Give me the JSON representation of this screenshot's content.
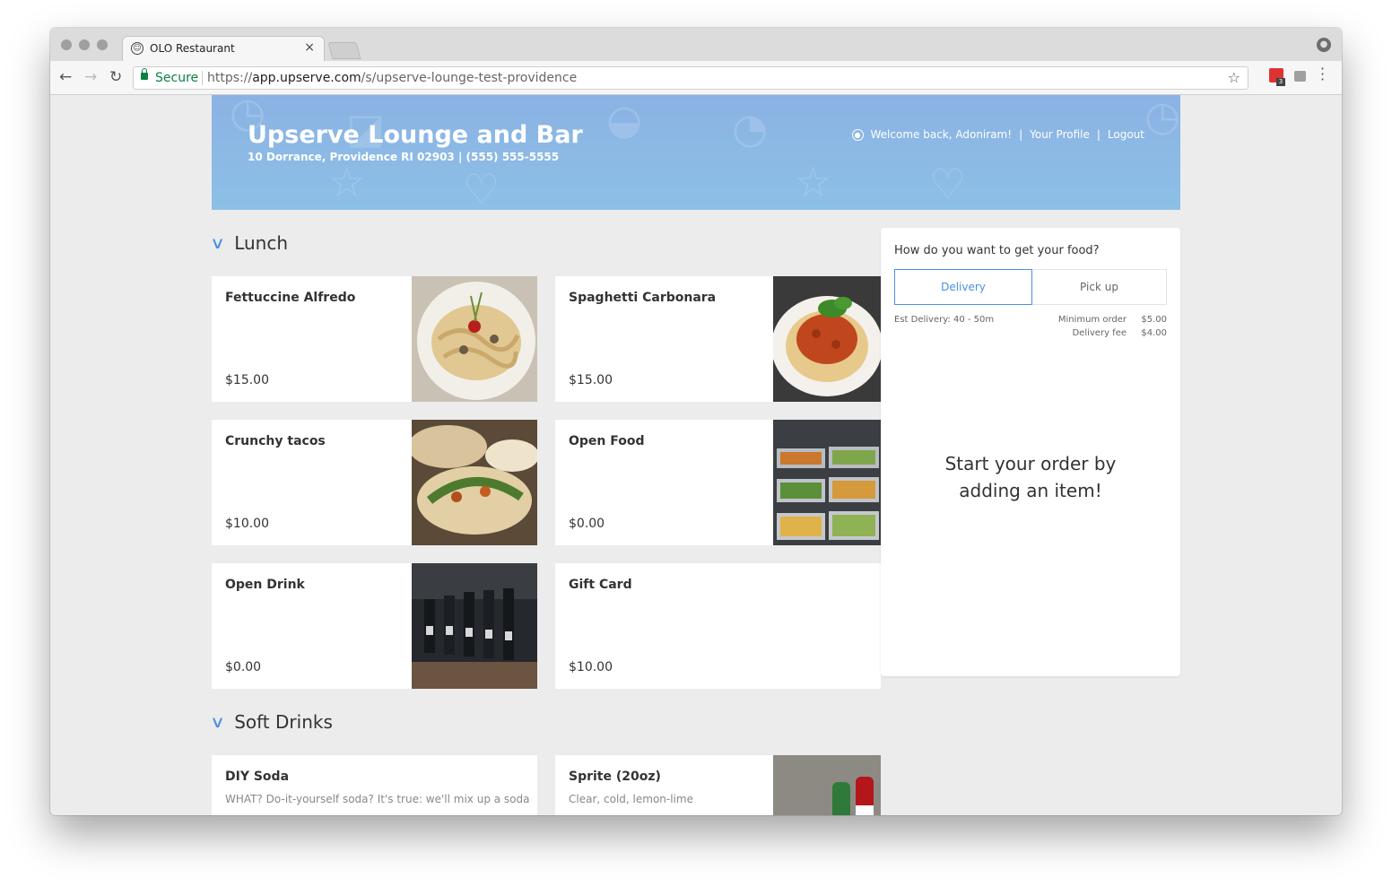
{
  "browser": {
    "tab_title": "OLO Restaurant",
    "secure_label": "Secure",
    "url_scheme": "https://",
    "url_host": "app.upserve.com",
    "url_path": "/s/upserve-lounge-test-providence",
    "extension_badge": "3"
  },
  "restaurant": {
    "name": "Upserve Lounge and Bar",
    "address": "10 Dorrance, Providence RI 02903 | (555) 555-5555"
  },
  "user_nav": {
    "welcome": "Welcome back, Adoniram!",
    "profile": "Your Profile",
    "logout": "Logout",
    "separator": "|"
  },
  "menu": {
    "sections": [
      {
        "title": "Lunch",
        "items": [
          {
            "name": "Fettuccine Alfredo",
            "price": "$15.00"
          },
          {
            "name": "Spaghetti Carbonara",
            "price": "$15.00"
          },
          {
            "name": "Crunchy tacos",
            "price": "$10.00"
          },
          {
            "name": "Open Food",
            "price": "$0.00"
          },
          {
            "name": "Open Drink",
            "price": "$0.00"
          },
          {
            "name": "Gift Card",
            "price": "$10.00"
          }
        ]
      },
      {
        "title": "Soft Drinks",
        "items": [
          {
            "name": "DIY Soda",
            "description": "WHAT? Do-it-yourself soda? It's true: we'll mix up a soda"
          },
          {
            "name": "Sprite (20oz)",
            "description": "Clear, cold, lemon-lime"
          }
        ]
      }
    ]
  },
  "order": {
    "question": "How do you want to get your food?",
    "delivery_label": "Delivery",
    "pickup_label": "Pick up",
    "est_delivery": "Est Delivery: 40 - 50m",
    "min_order_label": "Minimum order",
    "min_order_value": "$5.00",
    "delivery_fee_label": "Delivery fee",
    "delivery_fee_value": "$4.00",
    "empty_line1": "Start your order by",
    "empty_line2": "adding an item!"
  },
  "colors": {
    "accent": "#4a90e2",
    "hero_blue": "#8bb2e4",
    "secure_green": "#0b8043"
  }
}
